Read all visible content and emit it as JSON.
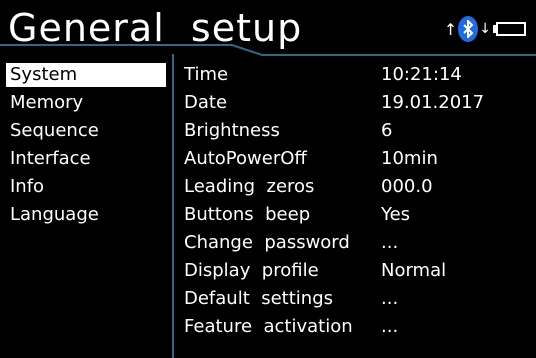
{
  "header": {
    "title": "General  setup",
    "status_icons": [
      "arrow-up-icon",
      "bluetooth-icon",
      "arrow-down-icon",
      "battery-icon"
    ],
    "bluetooth_color": "#1e6be3"
  },
  "sidebar": {
    "items": [
      {
        "label": "System",
        "selected": true
      },
      {
        "label": "Memory",
        "selected": false
      },
      {
        "label": "Sequence",
        "selected": false
      },
      {
        "label": "Interface",
        "selected": false
      },
      {
        "label": "Info",
        "selected": false
      },
      {
        "label": "Language",
        "selected": false
      }
    ]
  },
  "settings": {
    "rows": [
      {
        "label": "Time",
        "value": "10:21:14"
      },
      {
        "label": "Date",
        "value": "19.01.2017"
      },
      {
        "label": "Brightness",
        "value": "6"
      },
      {
        "label": "AutoPowerOff",
        "value": "10min"
      },
      {
        "label": "Leading  zeros",
        "value": "000.0"
      },
      {
        "label": "Buttons  beep",
        "value": "Yes"
      },
      {
        "label": "Change  password",
        "value": "..."
      },
      {
        "label": "Display  profile",
        "value": "Normal"
      },
      {
        "label": "Default  settings",
        "value": "..."
      },
      {
        "label": "Feature  activation",
        "value": "..."
      }
    ]
  }
}
